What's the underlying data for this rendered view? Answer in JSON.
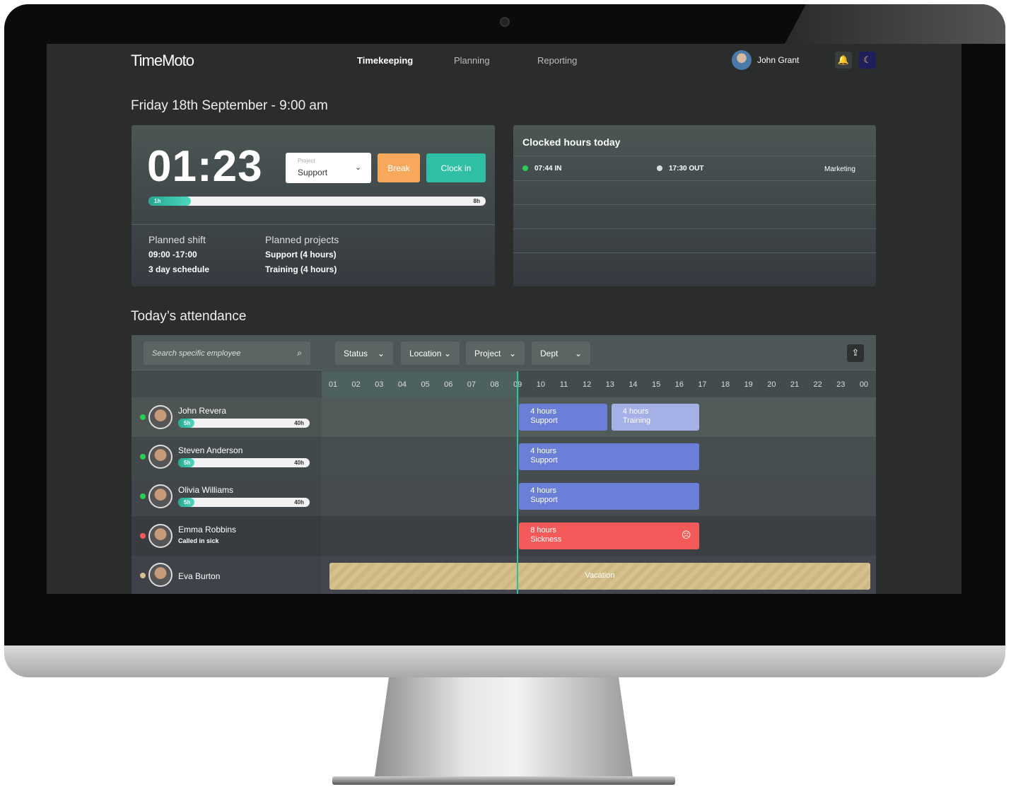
{
  "header": {
    "logo": "TimeMoto",
    "nav": [
      {
        "label": "Timekeeping",
        "active": true
      },
      {
        "label": "Planning",
        "active": false
      },
      {
        "label": "Reporting",
        "active": false
      }
    ],
    "user": "John Grant",
    "icons": [
      "bell-icon",
      "moon-icon"
    ]
  },
  "date_title": "Friday 18th September - 9:00 am",
  "timer": {
    "value": "01:23",
    "project_label": "Project",
    "project_value": "Support",
    "break_label": "Break",
    "clockin_label": "Clock in",
    "progress_start": "1h",
    "progress_end": "8h",
    "progress": 0.125
  },
  "shift": {
    "title": "Planned shift",
    "hours": "09:00 -17:00",
    "schedule": "3 day schedule"
  },
  "projects": {
    "title": "Planned projects",
    "items": [
      "Support (4 hours)",
      "Training (4 hours)"
    ]
  },
  "clocked": {
    "title": "Clocked hours today",
    "in": "07:44 IN",
    "out": "17:30 OUT",
    "dept": "Marketing"
  },
  "attendance": {
    "title": "Today’s attendance",
    "search_placeholder": "Search specific employee",
    "filters": [
      "Status",
      "Location",
      "Project",
      "Dept"
    ],
    "hours": [
      "01",
      "02",
      "03",
      "04",
      "05",
      "06",
      "07",
      "08",
      "09",
      "10",
      "11",
      "12",
      "13",
      "14",
      "15",
      "16",
      "17",
      "18",
      "19",
      "20",
      "21",
      "22",
      "23",
      "00"
    ],
    "now_hour": 9,
    "colors": {
      "support": "#6b7fd8",
      "training": "#a5b0e6",
      "sickness": "#f45a5a",
      "vacation": "#d6c08c",
      "online": "#2ecc55",
      "sick": "#f45a5a",
      "vacation_dot": "#d6c08c"
    },
    "employees": [
      {
        "name": "John Revera",
        "status": "online",
        "hours_done": "5h",
        "hours_total": "40h",
        "progress": 0.125,
        "blocks": [
          {
            "hours": "4 hours",
            "label": "Support",
            "start": 9,
            "end": 13,
            "type": "support"
          },
          {
            "hours": "4 hours",
            "label": "Training",
            "start": 13,
            "end": 17,
            "type": "training"
          }
        ]
      },
      {
        "name": "Steven Anderson",
        "status": "online",
        "hours_done": "5h",
        "hours_total": "40h",
        "progress": 0.125,
        "blocks": [
          {
            "hours": "4 hours",
            "label": "Support",
            "start": 9,
            "end": 17,
            "type": "support"
          }
        ]
      },
      {
        "name": "Olivia Williams",
        "status": "online",
        "hours_done": "5h",
        "hours_total": "40h",
        "progress": 0.125,
        "blocks": [
          {
            "hours": "4 hours",
            "label": "Support",
            "start": 9,
            "end": 17,
            "type": "support"
          }
        ]
      },
      {
        "name": "Emma Robbins",
        "status": "sick",
        "note": "Called in sick",
        "blocks": [
          {
            "hours": "8 hours",
            "label": "Sickness",
            "start": 9,
            "end": 17,
            "type": "sickness"
          }
        ]
      },
      {
        "name": "Eva Burton",
        "status": "vacation_dot",
        "blocks": [
          {
            "hours": "",
            "label": "Vacation",
            "start": 1,
            "end": 24.3,
            "type": "vacation"
          }
        ]
      }
    ]
  }
}
